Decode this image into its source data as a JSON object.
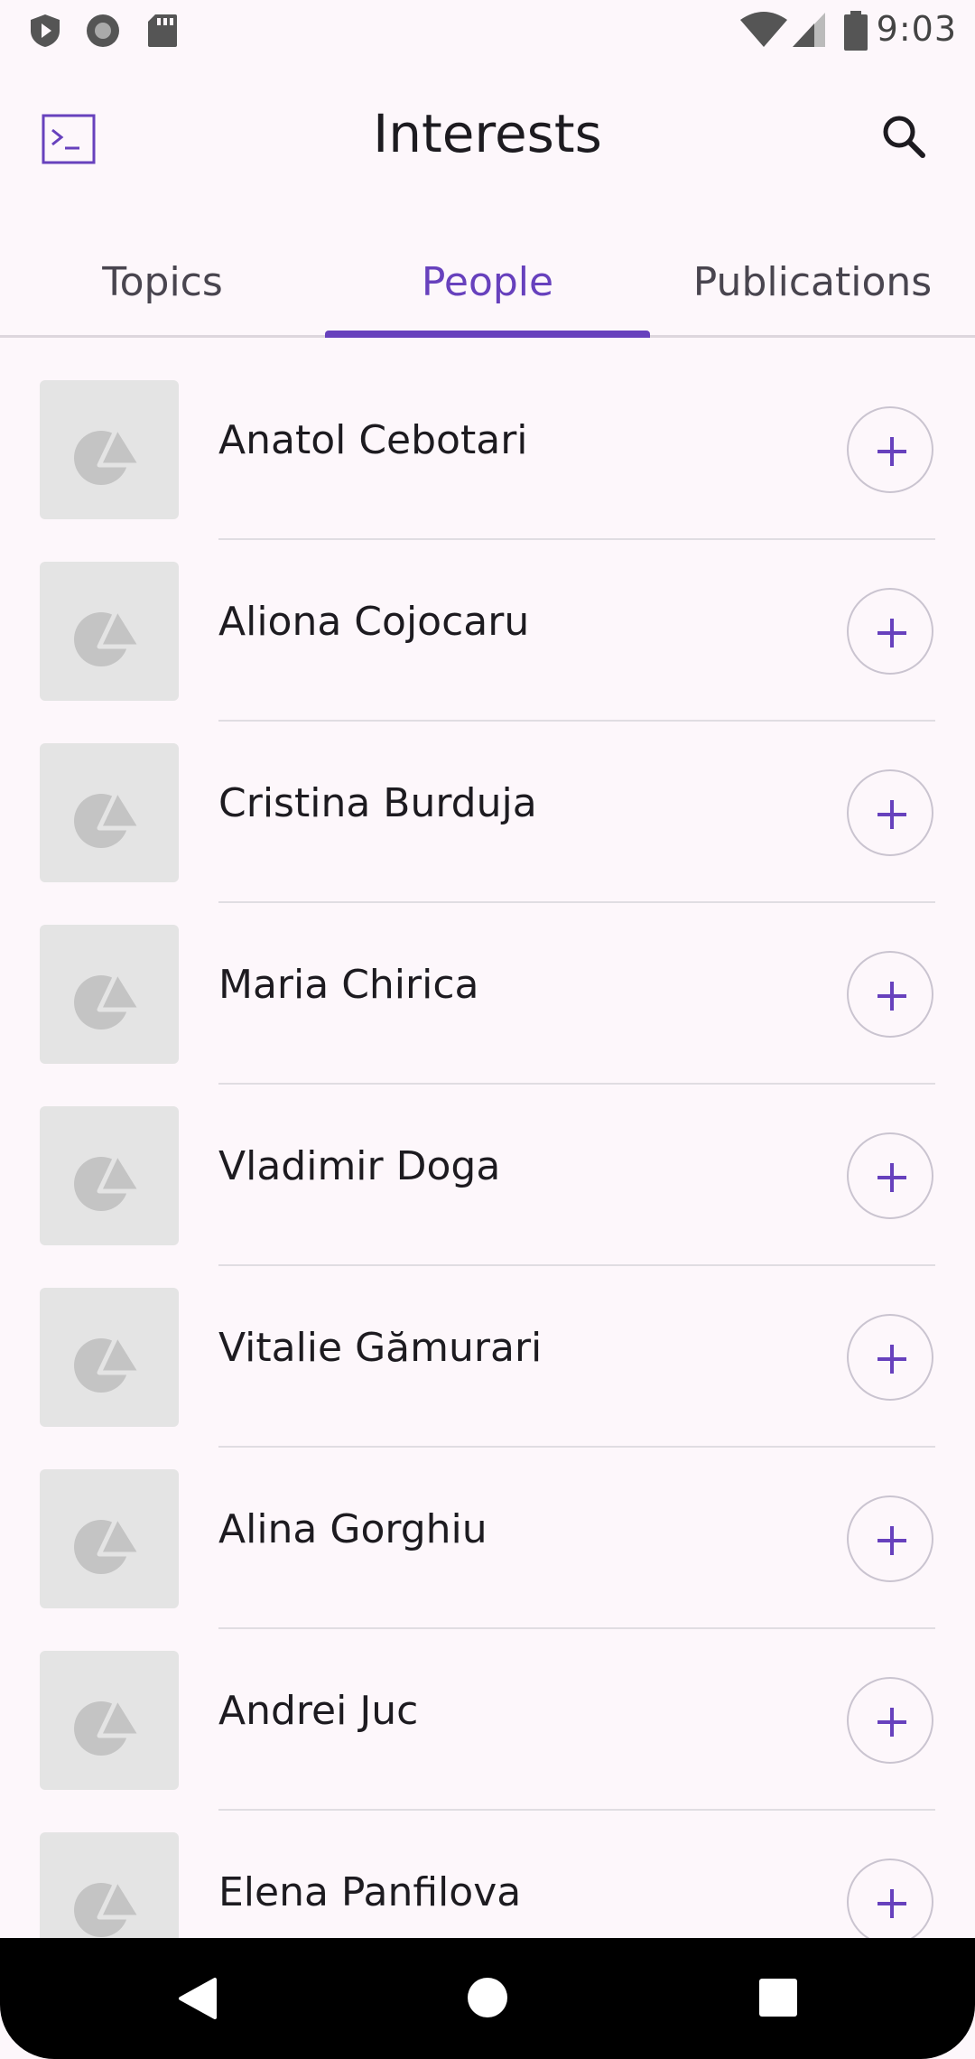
{
  "status_bar": {
    "time": "9:03",
    "icons": [
      "shield-notification-icon",
      "record-circle-icon",
      "sd-card-icon",
      "wifi-icon",
      "signal-icon",
      "battery-icon"
    ]
  },
  "app_bar": {
    "title": "Interests",
    "nav_icon": "terminal-icon",
    "action_icon": "search-icon"
  },
  "tabs": [
    {
      "label": "Topics",
      "selected": false
    },
    {
      "label": "People",
      "selected": true
    },
    {
      "label": "Publications",
      "selected": false
    }
  ],
  "people": [
    {
      "name": "Anatol Cebotari"
    },
    {
      "name": "Aliona Cojocaru"
    },
    {
      "name": "Cristina Burduja"
    },
    {
      "name": "Maria Chirica"
    },
    {
      "name": "Vladimir Doga"
    },
    {
      "name": "Vitalie Gămurari"
    },
    {
      "name": "Alina Gorghiu"
    },
    {
      "name": "Andrei Juc"
    },
    {
      "name": "Elena Panfilova"
    }
  ],
  "follow_icon": "plus-icon",
  "nav_bar": {
    "icons": [
      "back-icon",
      "home-icon",
      "recents-icon"
    ]
  },
  "colors": {
    "accent": "#6741bd",
    "background": "#fdf7fb",
    "avatar_placeholder": "#e4e4e4"
  }
}
